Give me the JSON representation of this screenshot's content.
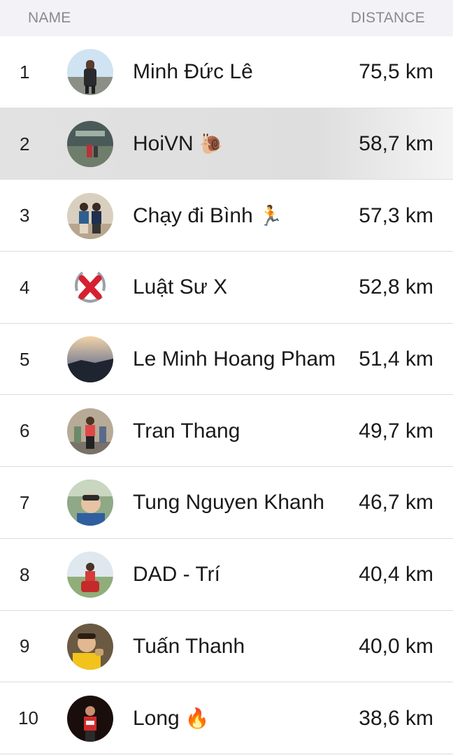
{
  "header": {
    "name_label": "NAME",
    "distance_label": "DISTANCE"
  },
  "rows": [
    {
      "rank": "1",
      "name": "Minh Đức Lê",
      "emoji": "",
      "distance": "75,5 km"
    },
    {
      "rank": "2",
      "name": "HoiVN",
      "emoji": "🐌",
      "distance": "58,7 km"
    },
    {
      "rank": "3",
      "name": "Chạy đi Bình",
      "emoji": "🏃",
      "distance": "57,3 km"
    },
    {
      "rank": "4",
      "name": "Luật Sư X",
      "emoji": "",
      "distance": "52,8 km"
    },
    {
      "rank": "5",
      "name": "Le Minh Hoang Pham",
      "emoji": "",
      "distance": "51,4 km"
    },
    {
      "rank": "6",
      "name": "Tran Thang",
      "emoji": "",
      "distance": "49,7 km"
    },
    {
      "rank": "7",
      "name": "Tung Nguyen Khanh",
      "emoji": "",
      "distance": "46,7 km"
    },
    {
      "rank": "8",
      "name": "DAD - Trí",
      "emoji": "",
      "distance": "40,4 km"
    },
    {
      "rank": "9",
      "name": "Tuấn Thanh",
      "emoji": "",
      "distance": "40,0 km"
    },
    {
      "rank": "10",
      "name": "Long",
      "emoji": "🔥",
      "distance": "38,6 km"
    }
  ]
}
